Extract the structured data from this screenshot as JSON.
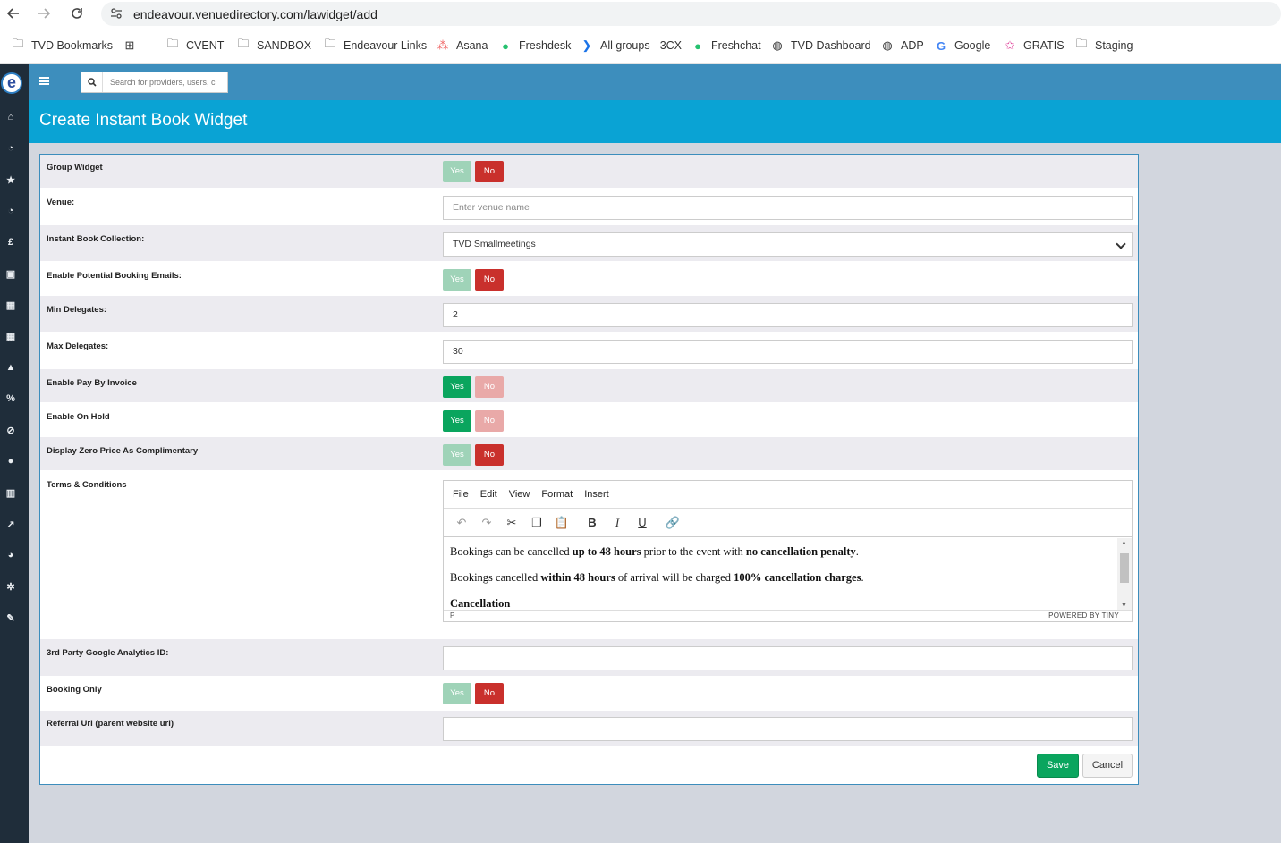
{
  "browser": {
    "url": "endeavour.venuedirectory.com/lawidget/add",
    "bookmarks": [
      {
        "label": "TVD Bookmarks",
        "icon": "folder-icon"
      },
      {
        "label": "",
        "icon": "apps-grid-icon"
      },
      {
        "label": "CVENT",
        "icon": "folder-icon"
      },
      {
        "label": "SANDBOX",
        "icon": "folder-icon"
      },
      {
        "label": "Endeavour Links",
        "icon": "folder-icon"
      },
      {
        "label": "Asana",
        "icon": "asana-icon"
      },
      {
        "label": "Freshdesk",
        "icon": "freshdesk-icon"
      },
      {
        "label": "All groups - 3CX",
        "icon": "3cx-icon"
      },
      {
        "label": "Freshchat",
        "icon": "freshchat-icon"
      },
      {
        "label": "TVD Dashboard",
        "icon": "globe-icon"
      },
      {
        "label": "ADP",
        "icon": "globe-icon"
      },
      {
        "label": "Google",
        "icon": "google-icon"
      },
      {
        "label": "GRATIS",
        "icon": "star-icon"
      },
      {
        "label": "Staging",
        "icon": "folder-icon"
      }
    ]
  },
  "app": {
    "logo_letter": "e",
    "search_placeholder": "Search for providers, users, c",
    "page_title": "Create Instant Book Widget"
  },
  "form": {
    "group_widget_label": "Group Widget",
    "venue_label": "Venue:",
    "venue_placeholder": "Enter venue name",
    "collection_label": "Instant Book Collection:",
    "collection_value": "TVD Smallmeetings",
    "potential_emails_label": "Enable Potential Booking Emails:",
    "min_delegates_label": "Min Delegates:",
    "min_delegates_value": "2",
    "max_delegates_label": "Max Delegates:",
    "max_delegates_value": "30",
    "pay_invoice_label": "Enable Pay By Invoice",
    "on_hold_label": "Enable On Hold",
    "zero_price_label": "Display Zero Price As Complimentary",
    "terms_label": "Terms & Conditions",
    "ga_label": "3rd Party Google Analytics ID:",
    "booking_only_label": "Booking Only",
    "referral_label": "Referral Url (parent website url)",
    "yes": "Yes",
    "no": "No"
  },
  "editor": {
    "menu": [
      "File",
      "Edit",
      "View",
      "Format",
      "Insert"
    ],
    "line1": {
      "a": "Bookings can be cancelled ",
      "b": "up to 48 hours",
      "c": " prior to the event with ",
      "d": "no cancellation penalty",
      "e": "."
    },
    "line2": {
      "a": "Bookings cancelled ",
      "b": "within 48 hours",
      "c": " of arrival will be charged ",
      "d": "100% cancellation charges",
      "e": "."
    },
    "line3": "Cancellation",
    "status_path": "P",
    "powered": "POWERED BY TINY"
  },
  "actions": {
    "save": "Save",
    "cancel": "Cancel"
  }
}
